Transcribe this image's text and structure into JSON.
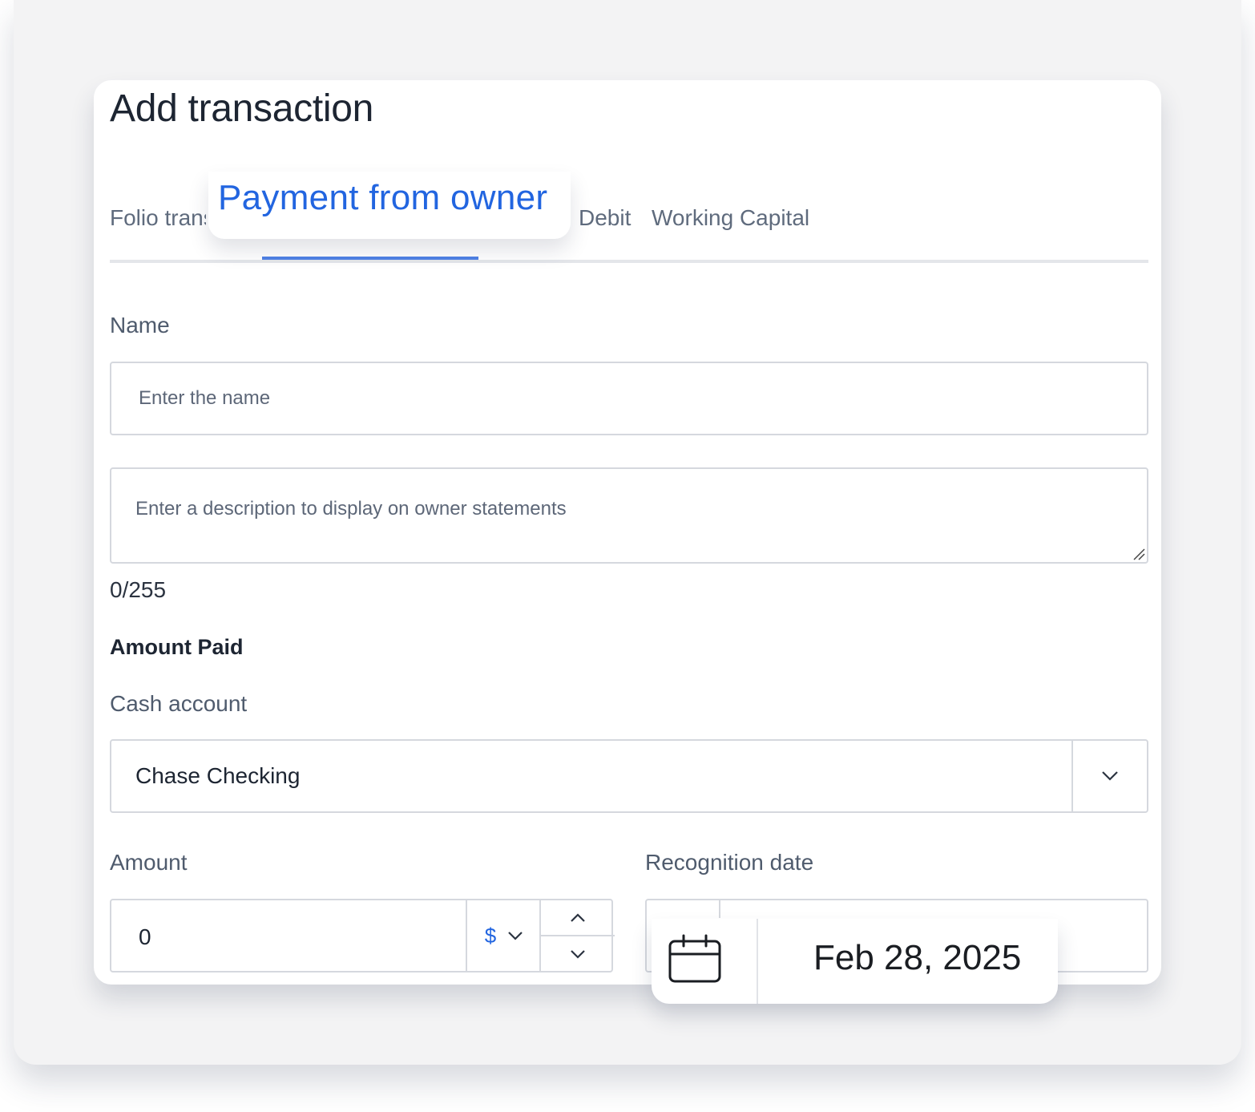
{
  "dialog": {
    "title": "Add transaction"
  },
  "tabs": {
    "items": [
      {
        "label": "Folio transactions"
      },
      {
        "label": "Payment from owner",
        "active": true
      },
      {
        "label": "Debit"
      },
      {
        "label": "Working Capital"
      }
    ],
    "active_color": "#2265e0"
  },
  "form": {
    "name_label": "Name",
    "name_placeholder": "Enter the name",
    "description_placeholder": "Enter a description to display on owner statements",
    "char_counter": "0/255",
    "section_title": "Amount Paid",
    "cash_account_label": "Cash account",
    "cash_account_value": "Chase Checking",
    "amount_label": "Amount",
    "amount_value": "0",
    "currency_symbol": "$",
    "recognition_date_label": "Recognition date",
    "recognition_date_value": "Feb 28, 2025"
  },
  "icons": {
    "select_arrow": "chevron-down-icon",
    "currency_arrow": "chevron-down-icon",
    "step_up": "chevron-up-icon",
    "step_down": "chevron-down-icon",
    "date": "calendar-icon",
    "resize": "resize-grip-icon"
  }
}
